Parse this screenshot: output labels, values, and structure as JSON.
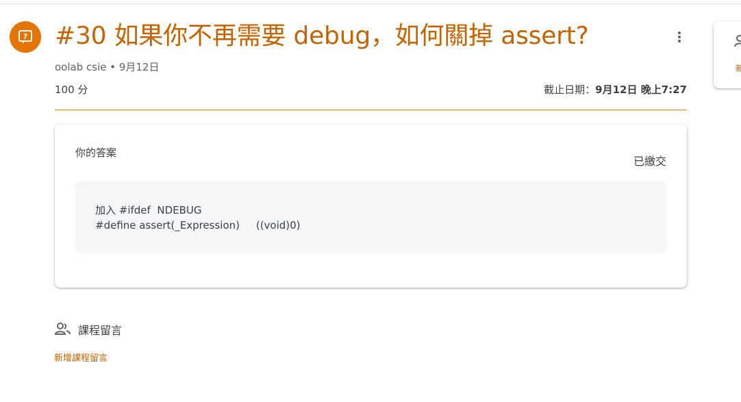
{
  "assignment": {
    "title": "#30 如果你不再需要 debug，如何關掉 assert?",
    "author_date": "oolab csie • 9月12日",
    "points": "100 分",
    "due_label": "截止日期：",
    "due_value": "9月12日 晚上7:27"
  },
  "answer_card": {
    "title": "你的答案",
    "status": "已繳交",
    "answer_lines": [
      "加入 #ifdef  NDEBUG",
      "#define assert(_Expression)     ((void)0)"
    ]
  },
  "class_comments": {
    "title": "課程留言",
    "add_link": "新增課程留言"
  },
  "side_panel": {
    "link_fragment": "新"
  },
  "colors": {
    "accent": "#c26401",
    "icon_bg": "#e37400",
    "divider": "#c58a1a",
    "answer_bg": "#f5f6f8"
  },
  "icons": {
    "question": "question-icon",
    "more": "more-vert-icon",
    "comments": "people-icon",
    "side": "person-icon"
  }
}
